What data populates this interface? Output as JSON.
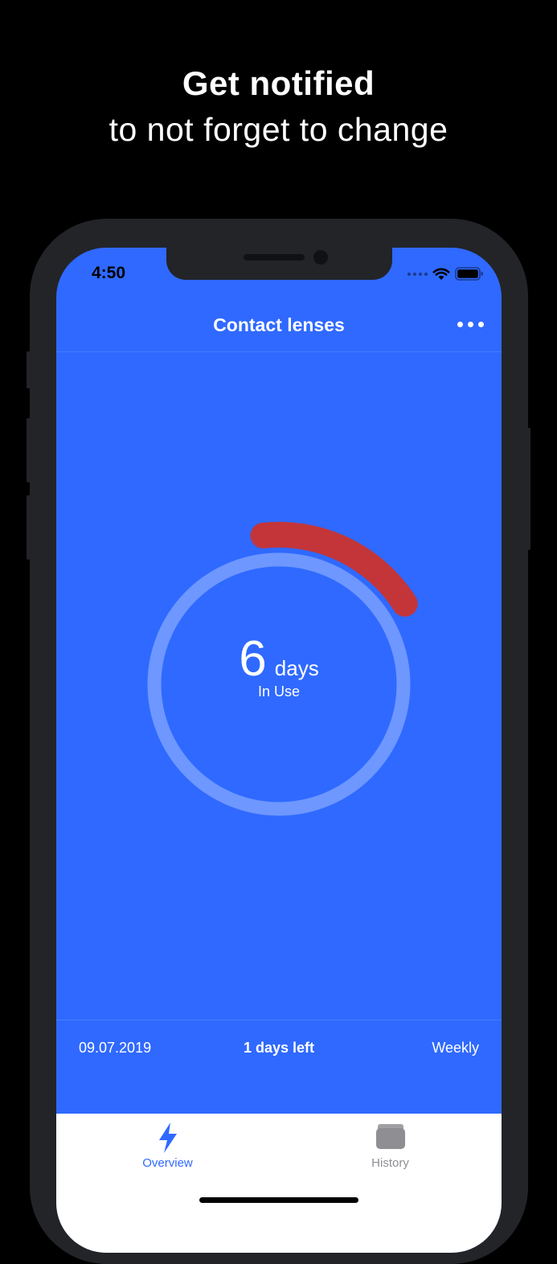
{
  "promo": {
    "title": "Get notified",
    "subtitle": "to not forget to change"
  },
  "status_bar": {
    "time": "4:50",
    "icons": [
      "cellular-dots-icon",
      "wifi-icon",
      "battery-icon"
    ]
  },
  "nav": {
    "title": "Contact lenses",
    "more_icon": "more-dots-icon"
  },
  "usage": {
    "days": "6",
    "unit": "days",
    "label": "In Use",
    "total_days": 7,
    "ring_color": "#6e97ff",
    "warning_color": "#c33539"
  },
  "info": {
    "start_date": "09.07.2019",
    "days_left": "1 days left",
    "frequency": "Weekly"
  },
  "tabs": [
    {
      "label": "Overview",
      "icon": "lightning-icon",
      "active": true
    },
    {
      "label": "History",
      "icon": "wallet-icon",
      "active": false
    }
  ],
  "colors": {
    "background": "#000000",
    "screen": "#2f69ff",
    "accent": "#2f69ff",
    "inactive": "#8e8e93"
  }
}
